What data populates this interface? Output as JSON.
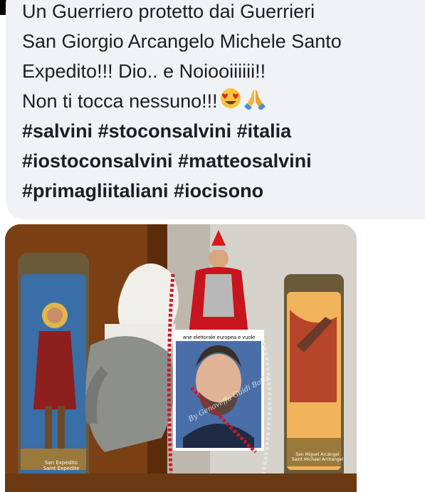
{
  "post": {
    "lines": [
      "Un Guerriero  protetto  dai Guerrieri",
      "San Giorgio  Arcangelo  Michele  Santo",
      "Expedito!!!  Dio.. e Noiooiiiiii!!",
      "Non ti tocca nessuno!!!"
    ],
    "emoji": [
      "heart-eyes-emoji",
      "folded-hands-emoji"
    ],
    "hashtag_lines": [
      "#salvini #stoconsalvini #italia",
      "#iostoconsalvini  #matteosalvini",
      "#primagliitaliani #iocisono"
    ]
  },
  "photo": {
    "candle_left_caption": [
      "San Expedito",
      "Saint Expedite"
    ],
    "candle_right_caption": [
      "San Miguel Arcángel",
      "Saint Michael Archangel"
    ],
    "banner_text": "ane elettorale europea e vuole",
    "watermark_text": "By Genoveffa Guidi Botta",
    "colors": {
      "bubble": "#f0f2f5",
      "text": "#1c1e21",
      "cape_red": "#c8141c",
      "candle_glass": "#f2b45a"
    }
  }
}
